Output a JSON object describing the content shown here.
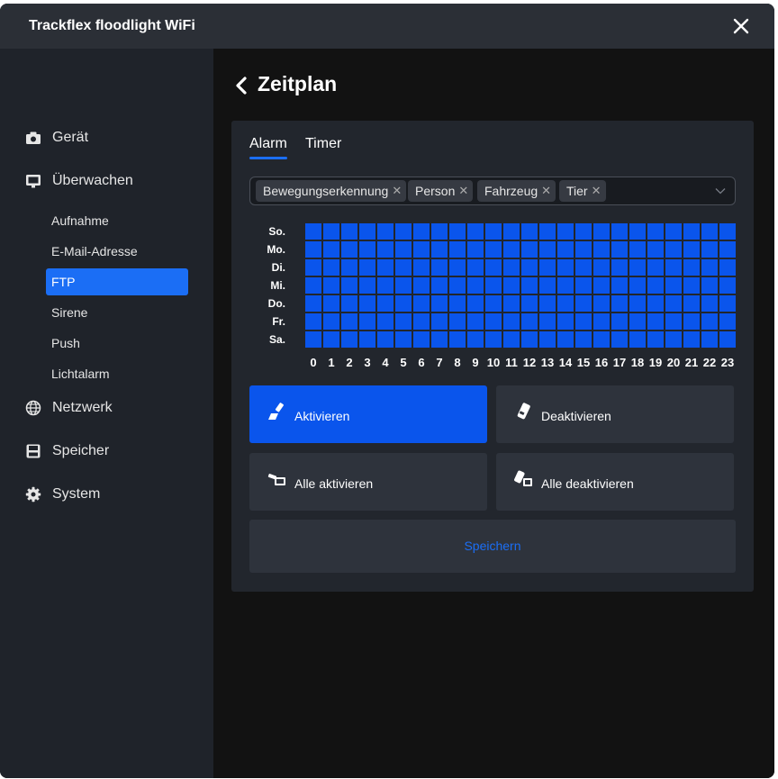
{
  "app": {
    "title": "Trackflex floodlight WiFi"
  },
  "sidebar": {
    "groups": [
      {
        "label": "Gerät",
        "icon": "camera-icon"
      },
      {
        "label": "Überwachen",
        "icon": "monitor-icon"
      },
      {
        "label": "Netzwerk",
        "icon": "globe-icon"
      },
      {
        "label": "Speicher",
        "icon": "floppy-disk-icon"
      },
      {
        "label": "System",
        "icon": "gear-icon"
      }
    ],
    "sub_items": [
      "Aufnahme",
      "E-Mail-Adresse",
      "FTP",
      "Sirene",
      "Push",
      "Lichtalarm"
    ],
    "active_sub": "FTP"
  },
  "page": {
    "title": "Zeitplan"
  },
  "tabs": [
    {
      "label": "Alarm",
      "active": true
    },
    {
      "label": "Timer",
      "active": false
    }
  ],
  "event_types": [
    "Bewegungserkennung",
    "Person",
    "Fahrzeug",
    "Tier"
  ],
  "schedule": {
    "days": [
      "So.",
      "Mo.",
      "Di.",
      "Mi.",
      "Do.",
      "Fr.",
      "Sa."
    ],
    "hours": [
      "0",
      "1",
      "2",
      "3",
      "4",
      "5",
      "6",
      "7",
      "8",
      "9",
      "10",
      "11",
      "12",
      "13",
      "14",
      "15",
      "16",
      "17",
      "18",
      "19",
      "20",
      "21",
      "22",
      "23"
    ],
    "active_color": "#0a55ec",
    "all_active": true
  },
  "actions": {
    "activate": "Aktivieren",
    "deactivate": "Deaktivieren",
    "activate_all": "Alle aktivieren",
    "deactivate_all": "Alle deaktivieren",
    "save": "Speichern"
  },
  "colors": {
    "accent": "#1b6ef5",
    "cell": "#0a55ec"
  }
}
